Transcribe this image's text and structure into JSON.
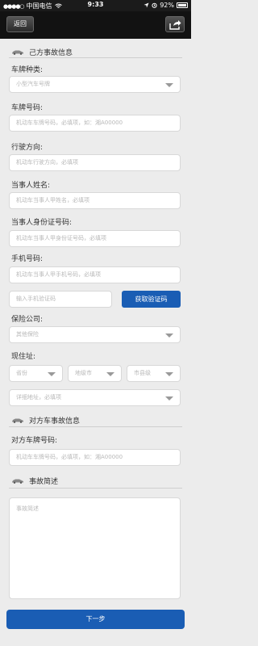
{
  "status_bar": {
    "signal": "●●●●○",
    "carrier": "中国电信",
    "time": "9:33",
    "battery": "92%"
  },
  "nav": {
    "back_label": "返回"
  },
  "sections": {
    "own": "己方事故信息",
    "other": "对方车事故信息",
    "summary": "事故简述"
  },
  "form": {
    "plate_type": {
      "label": "车牌种类:",
      "value": "小型汽车号牌"
    },
    "plate_no": {
      "label": "车牌号码:",
      "placeholder": "机动车车牌号码，必填项，如：湘A00000"
    },
    "direction": {
      "label": "行驶方向:",
      "placeholder": "机动车行驶方向，必填项"
    },
    "party_name": {
      "label": "当事人姓名:",
      "placeholder": "机动车当事人甲姓名，必填项"
    },
    "party_id": {
      "label": "当事人身份证号码:",
      "placeholder": "机动车当事人甲身份证号码，必填项"
    },
    "phone": {
      "label": "手机号码:",
      "placeholder": "机动车当事人甲手机号码，必填项"
    },
    "verify": {
      "placeholder": "输入手机验证码",
      "button": "获取验证码"
    },
    "insurance": {
      "label": "保险公司:",
      "value": "其他保险"
    },
    "address": {
      "label": "现住址:",
      "province": "省份",
      "city": "地级市",
      "county": "市县级",
      "detail_placeholder": "详细地址，必填项"
    },
    "other_plate": {
      "label": "对方车牌号码:",
      "placeholder": "机动车车牌号码，必填项，如：湘A00000"
    },
    "summary_placeholder": "事故简述"
  },
  "next_button": "下一步",
  "colors": {
    "accent": "#1a5db4",
    "bar": "#121212"
  }
}
